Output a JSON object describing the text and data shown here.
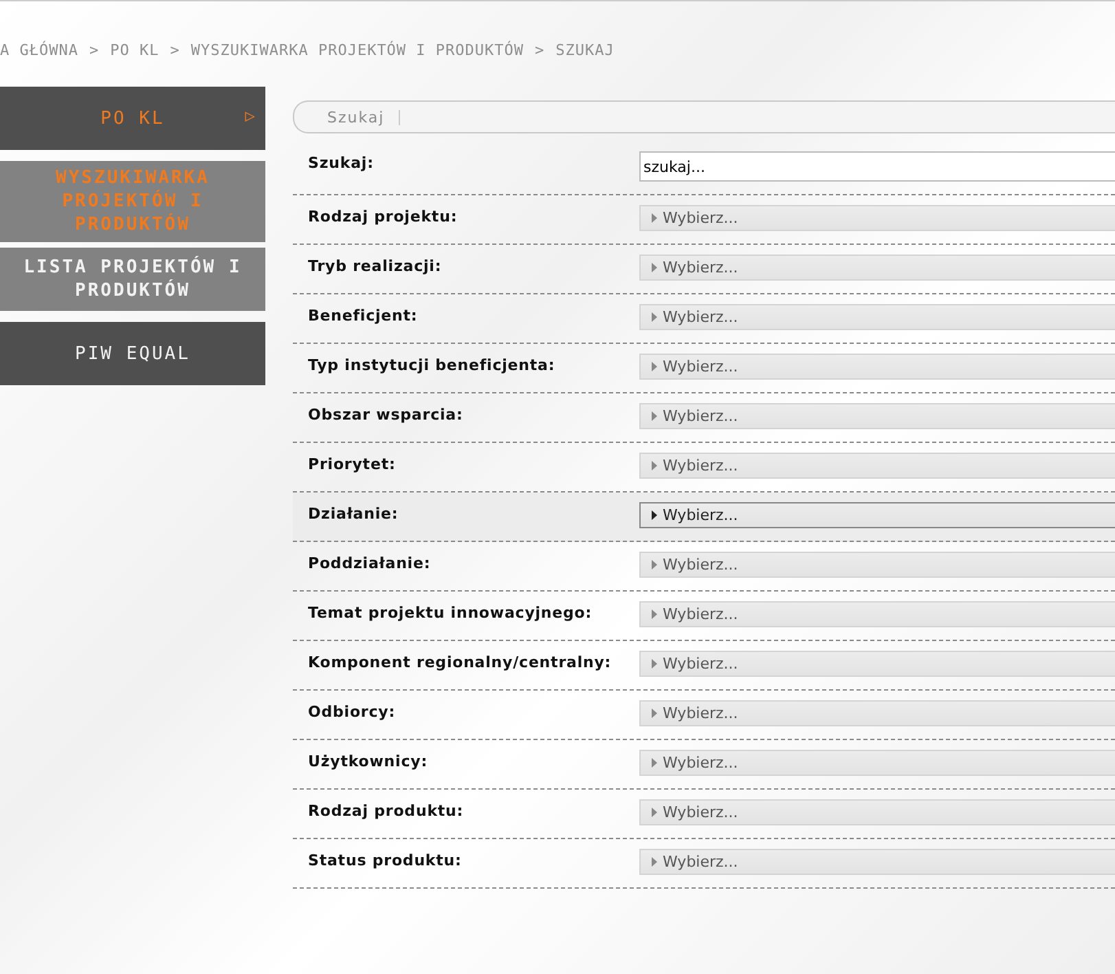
{
  "breadcrumb": [
    "A GŁÓWNA",
    "PO KL",
    "WYSZUKIWARKA PROJEKTÓW I PRODUKTÓW",
    "SZUKAJ"
  ],
  "breadcrumb_separator": ">",
  "sidebar": {
    "items": [
      {
        "label": "PO KL",
        "kind": "section",
        "selected": true,
        "arrow": "▷"
      },
      {
        "label": "WYSZUKIWARKA PROJEKTÓW I PRODUKTÓW",
        "kind": "sub",
        "selected": true
      },
      {
        "label": "LISTA PROJEKTÓW I PRODUKTÓW",
        "kind": "sub",
        "selected": false
      },
      {
        "label": "PIW EQUAL",
        "kind": "section",
        "selected": false
      }
    ]
  },
  "tab_bar": {
    "tabs": [
      {
        "label": "Szukaj",
        "selected": true
      }
    ]
  },
  "form": {
    "rows": [
      {
        "label": "Szukaj:",
        "kind": "text",
        "value": "szukaj...",
        "highlighted": false
      },
      {
        "label": "Rodzaj projektu:",
        "kind": "select",
        "value": "Wybierz...",
        "highlighted": false
      },
      {
        "label": "Tryb realizacji:",
        "kind": "select",
        "value": "Wybierz...",
        "highlighted": false
      },
      {
        "label": "Beneficjent:",
        "kind": "select",
        "value": "Wybierz...",
        "highlighted": false
      },
      {
        "label": "Typ instytucji beneficjenta:",
        "kind": "select",
        "value": "Wybierz...",
        "highlighted": false
      },
      {
        "label": "Obszar wsparcia:",
        "kind": "select",
        "value": "Wybierz...",
        "highlighted": false
      },
      {
        "label": "Priorytet:",
        "kind": "select",
        "value": "Wybierz...",
        "highlighted": false
      },
      {
        "label": "Działanie:",
        "kind": "select",
        "value": "Wybierz...",
        "highlighted": true
      },
      {
        "label": "Poddziałanie:",
        "kind": "select",
        "value": "Wybierz...",
        "highlighted": false
      },
      {
        "label": "Temat projektu innowacyjnego:",
        "kind": "select",
        "value": "Wybierz...",
        "highlighted": false
      },
      {
        "label": "Komponent regionalny/centralny:",
        "kind": "select",
        "value": "Wybierz...",
        "highlighted": false
      },
      {
        "label": "Odbiorcy:",
        "kind": "select",
        "value": "Wybierz...",
        "highlighted": false
      },
      {
        "label": "Użytkownicy:",
        "kind": "select",
        "value": "Wybierz...",
        "highlighted": false
      },
      {
        "label": "Rodzaj produktu:",
        "kind": "select",
        "value": "Wybierz...",
        "highlighted": false
      },
      {
        "label": "Status produktu:",
        "kind": "select",
        "value": "Wybierz...",
        "highlighted": false
      }
    ]
  }
}
